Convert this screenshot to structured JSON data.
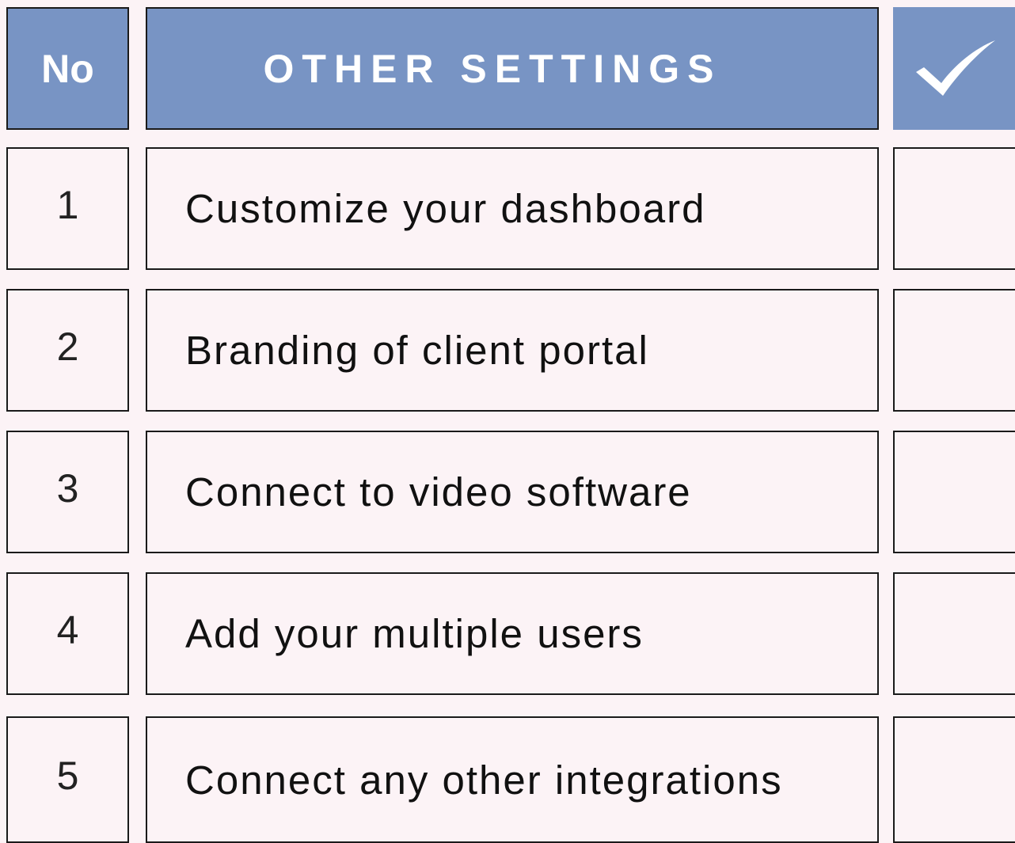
{
  "header": {
    "no_label": "No",
    "title": "OTHER SETTINGS",
    "check_icon": "checkmark-icon"
  },
  "colors": {
    "header_bg": "#7894c4",
    "page_bg": "#fcf3f6",
    "border": "#1a1a1a"
  },
  "rows": [
    {
      "number": "1",
      "text": "Customize your dashboard",
      "checked": false
    },
    {
      "number": "2",
      "text": "Branding of client portal",
      "checked": false
    },
    {
      "number": "3",
      "text": "Connect to video software",
      "checked": false
    },
    {
      "number": "4",
      "text": "Add your multiple users",
      "checked": false
    },
    {
      "number": "5",
      "text": "Connect any other integrations",
      "checked": false
    }
  ]
}
